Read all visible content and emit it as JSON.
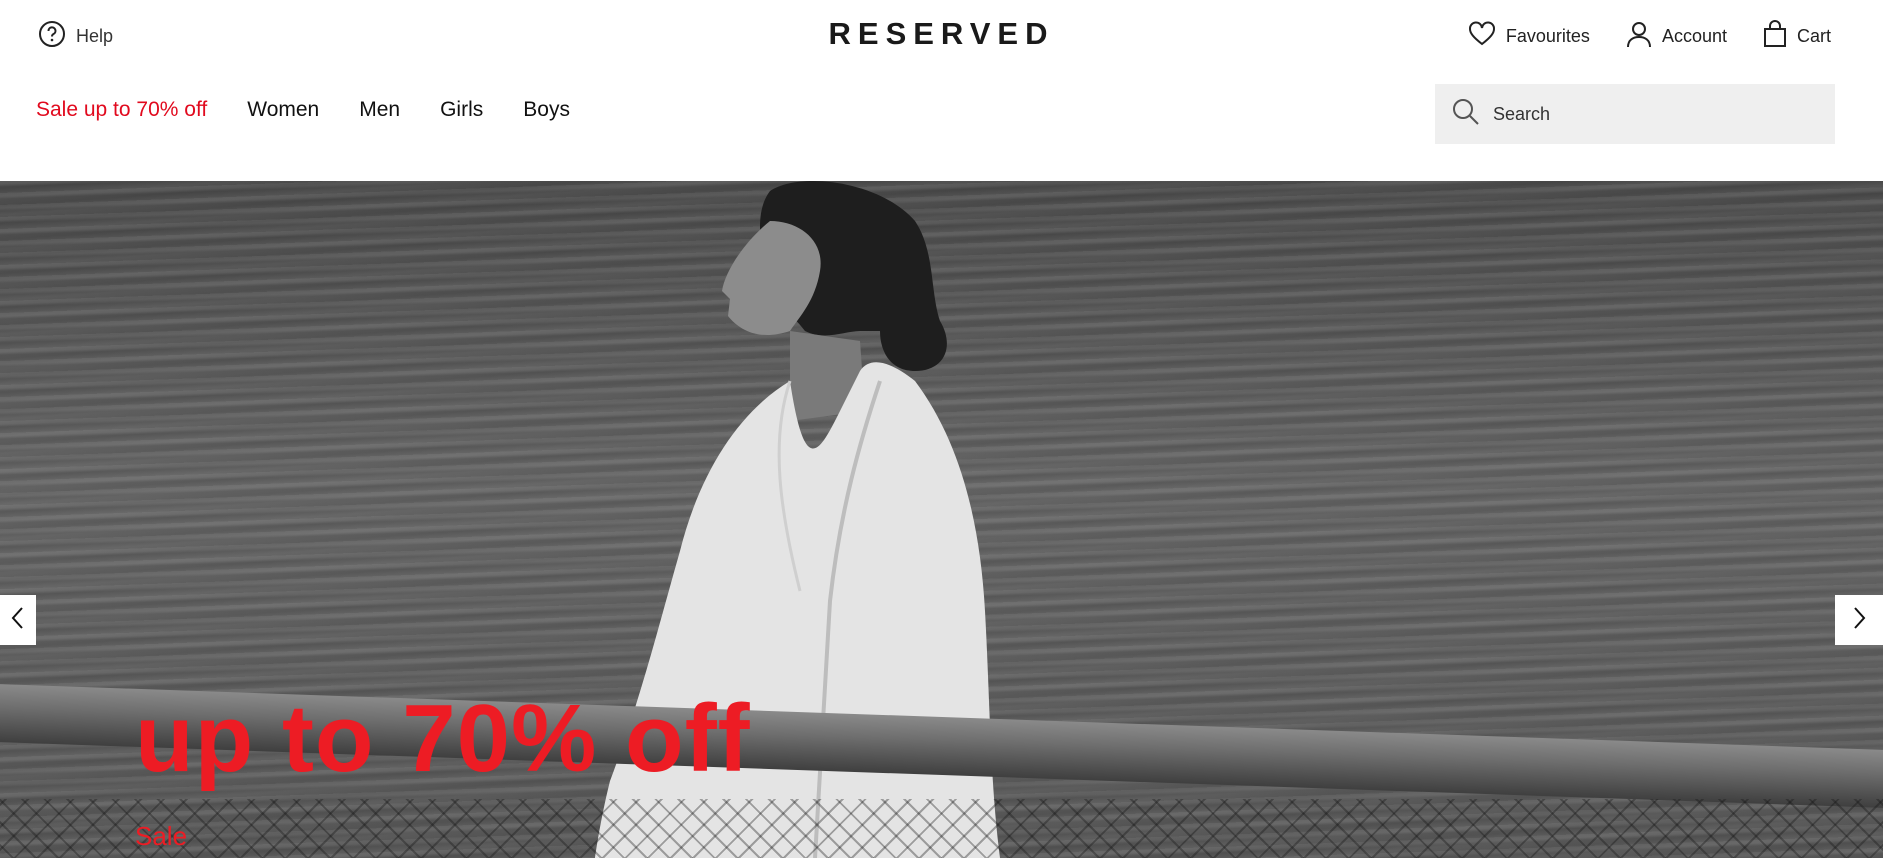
{
  "header": {
    "help_label": "Help",
    "logo": "RESERVED",
    "utility": [
      {
        "label": "Favourites",
        "icon": "heart-icon"
      },
      {
        "label": "Account",
        "icon": "user-icon"
      },
      {
        "label": "Cart",
        "icon": "bag-icon"
      }
    ]
  },
  "nav": {
    "items": [
      {
        "label": "Sale up to 70% off"
      },
      {
        "label": "Women"
      },
      {
        "label": "Men"
      },
      {
        "label": "Girls"
      },
      {
        "label": "Boys"
      }
    ]
  },
  "search": {
    "placeholder": "Search"
  },
  "hero": {
    "headline": "up to 70% off",
    "subline": "Sale",
    "accent_color": "#ed1c24"
  }
}
